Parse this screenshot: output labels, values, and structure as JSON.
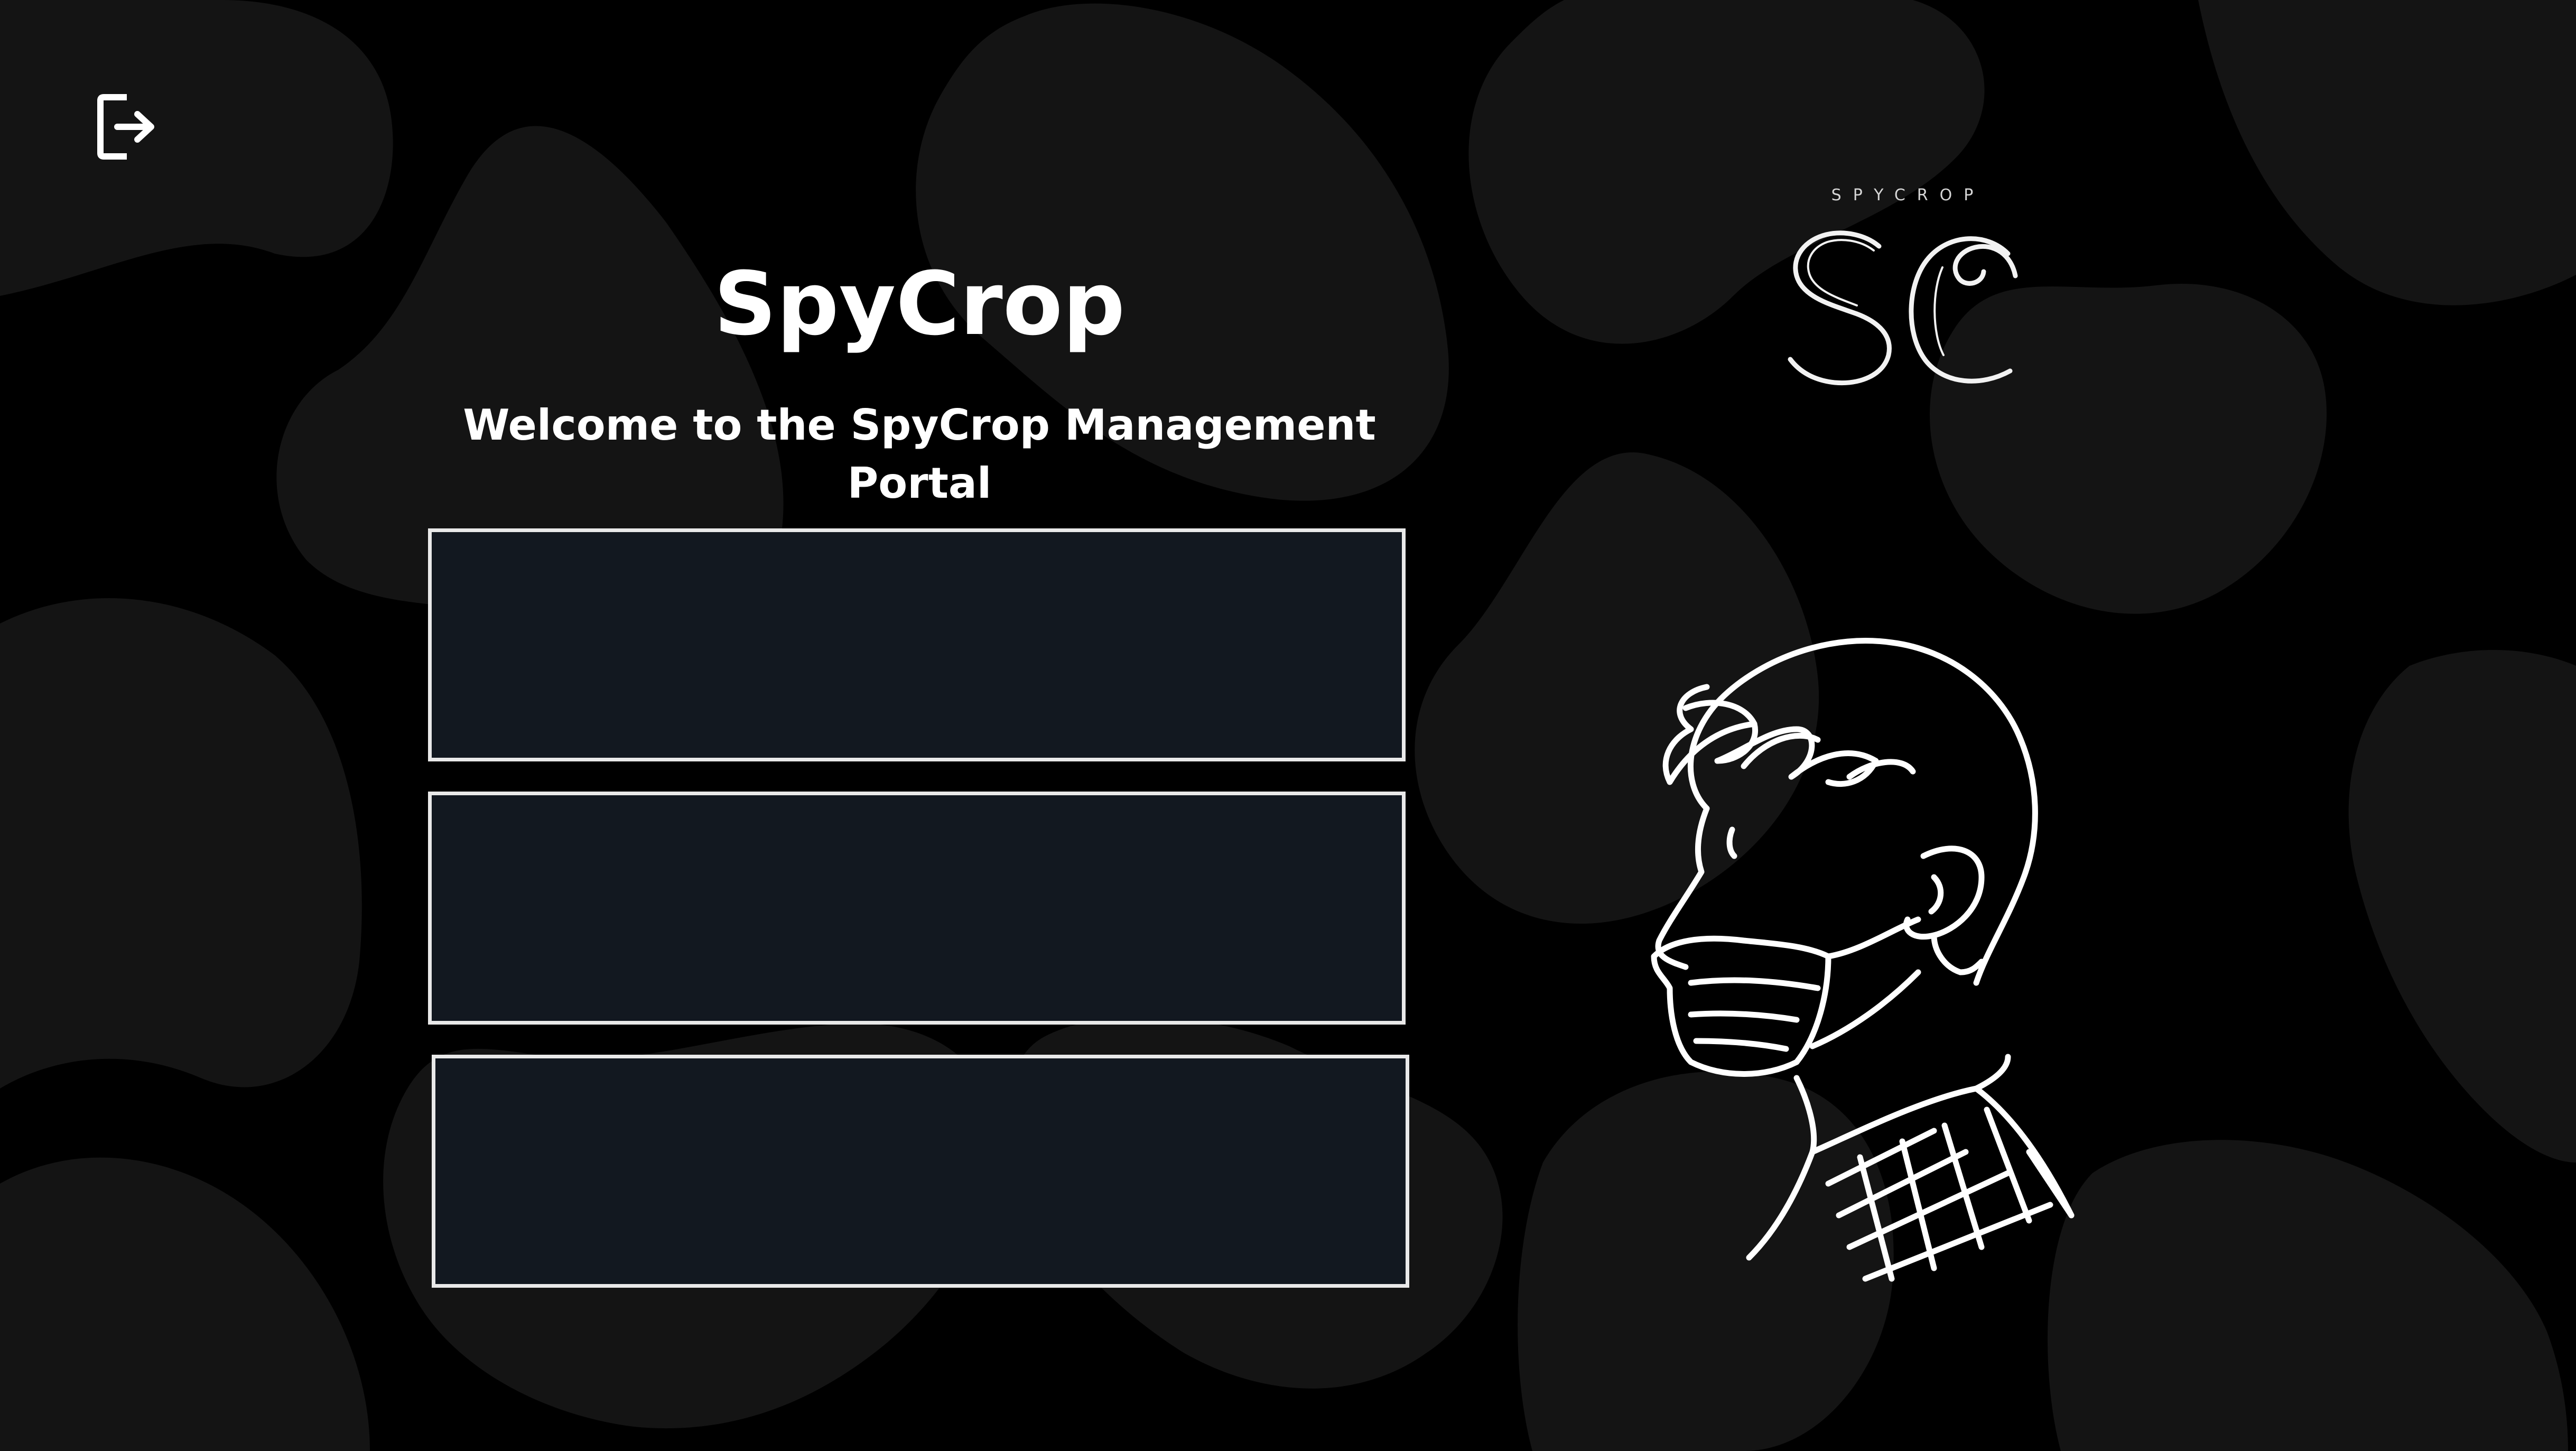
{
  "app": {
    "title": "SpyCrop",
    "welcome": "Welcome to the SpyCrop Management Portal"
  },
  "header": {
    "logout_icon": "logout-icon"
  },
  "brand": {
    "wordmark": "SPYCROP",
    "monogram": "SC"
  },
  "panels": [
    {
      "label": ""
    },
    {
      "label": ""
    },
    {
      "label": ""
    }
  ],
  "illustration": {
    "icon": "masked-person-illustration"
  },
  "colors": {
    "background": "#000000",
    "blob": "#141414",
    "panel_fill": "#121820",
    "panel_border": "#e9e9e9",
    "text": "#ffffff"
  }
}
